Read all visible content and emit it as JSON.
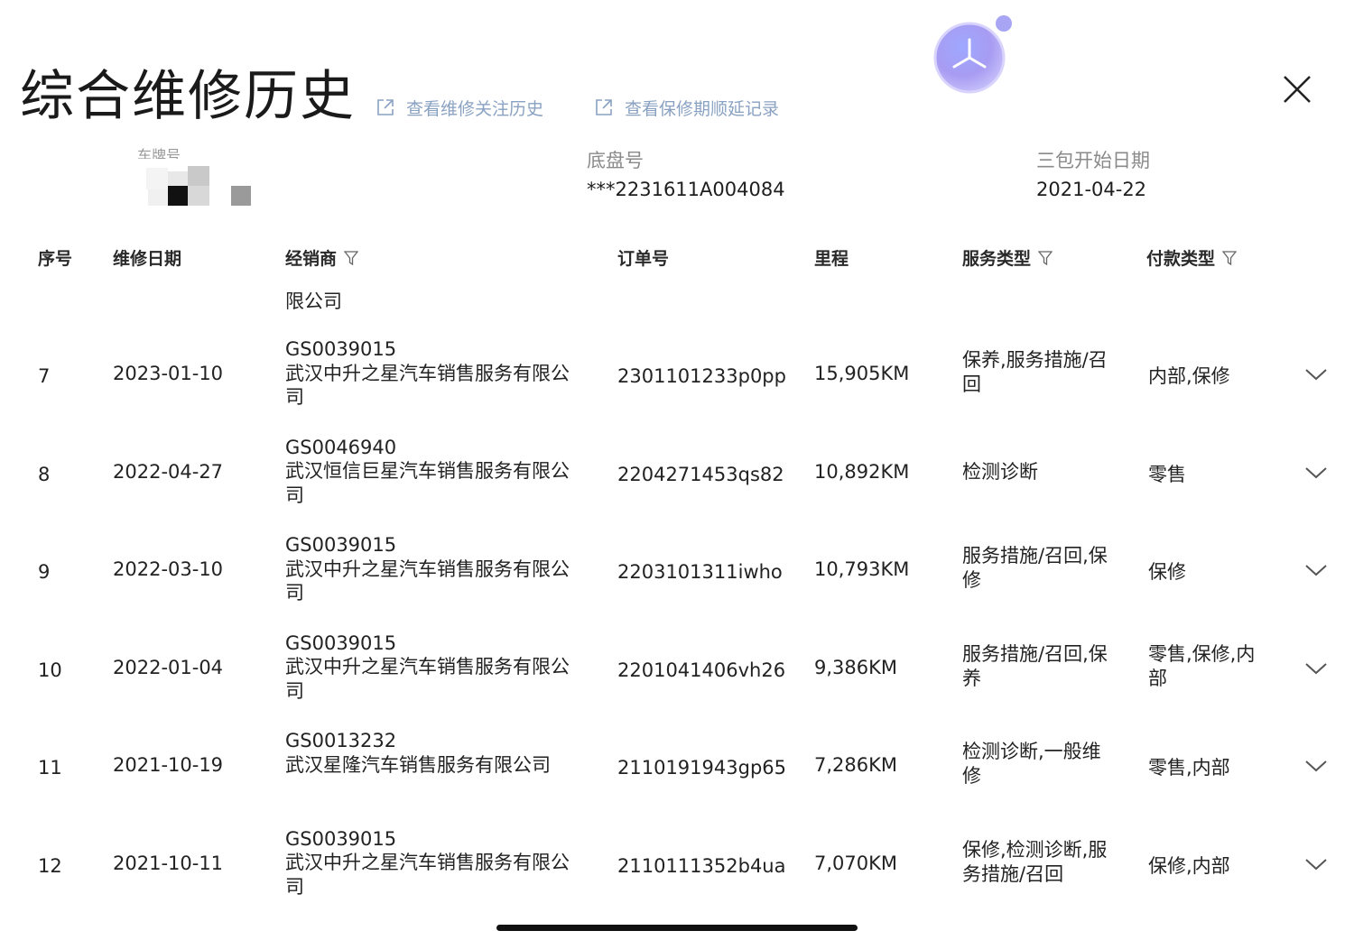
{
  "header": {
    "title": "综合维修历史",
    "links": [
      {
        "label": "查看维修关注历史",
        "icon": "external-link-icon"
      },
      {
        "label": "查看保修期顺延记录",
        "icon": "external-link-icon"
      }
    ],
    "assistant_icon": "assistant-orb-icon",
    "close_icon": "close-icon"
  },
  "vehicle": {
    "plate_label": "车牌号",
    "chassis_label": "底盘号",
    "chassis_value": "***2231611A004084",
    "warranty_label": "三包开始日期",
    "warranty_value": "2021-04-22"
  },
  "table": {
    "columns": [
      {
        "key": "seq",
        "label": "序号",
        "filter": false
      },
      {
        "key": "date",
        "label": "维修日期",
        "filter": false
      },
      {
        "key": "dealer",
        "label": "经销商",
        "filter": true
      },
      {
        "key": "order",
        "label": "订单号",
        "filter": false
      },
      {
        "key": "mileage",
        "label": "里程",
        "filter": false
      },
      {
        "key": "service_type",
        "label": "服务类型",
        "filter": true
      },
      {
        "key": "payment_type",
        "label": "付款类型",
        "filter": true
      }
    ],
    "partial_row_text": "限公司",
    "rows": [
      {
        "seq": "7",
        "date": "2023-01-10",
        "dealer_code": "GS0039015",
        "dealer_name": "武汉中升之星汽车销售服务有限公司",
        "order": "2301101233p0pp",
        "mileage": "15,905KM",
        "service_type": "保养,服务措施/召回",
        "payment_type": "内部,保修"
      },
      {
        "seq": "8",
        "date": "2022-04-27",
        "dealer_code": "GS0046940",
        "dealer_name": "武汉恒信巨星汽车销售服务有限公司",
        "order": "2204271453qs82",
        "mileage": "10,892KM",
        "service_type": "检测诊断",
        "payment_type": "零售"
      },
      {
        "seq": "9",
        "date": "2022-03-10",
        "dealer_code": "GS0039015",
        "dealer_name": "武汉中升之星汽车销售服务有限公司",
        "order": "2203101311iwho",
        "mileage": "10,793KM",
        "service_type": "服务措施/召回,保修",
        "payment_type": "保修"
      },
      {
        "seq": "10",
        "date": "2022-01-04",
        "dealer_code": "GS0039015",
        "dealer_name": "武汉中升之星汽车销售服务有限公司",
        "order": "2201041406vh26",
        "mileage": "9,386KM",
        "service_type": "服务措施/召回,保养",
        "payment_type": "零售,保修,内部"
      },
      {
        "seq": "11",
        "date": "2021-10-19",
        "dealer_code": "GS0013232",
        "dealer_name": "武汉星隆汽车销售服务有限公司",
        "order": "2110191943gp65",
        "mileage": "7,286KM",
        "service_type": "检测诊断,一般维修",
        "payment_type": "零售,内部"
      },
      {
        "seq": "12",
        "date": "2021-10-11",
        "dealer_code": "GS0039015",
        "dealer_name": "武汉中升之星汽车销售服务有限公司",
        "order": "2110111352b4ua",
        "mileage": "7,070KM",
        "service_type": "保修,检测诊断,服务措施/召回",
        "payment_type": "保修,内部"
      }
    ],
    "expand_icon": "chevron-down-icon"
  },
  "colors": {
    "accent_link": "#8aa2c2",
    "text_primary": "#222222",
    "text_label": "#8a8a8a",
    "orb": "#a9a5f5"
  }
}
